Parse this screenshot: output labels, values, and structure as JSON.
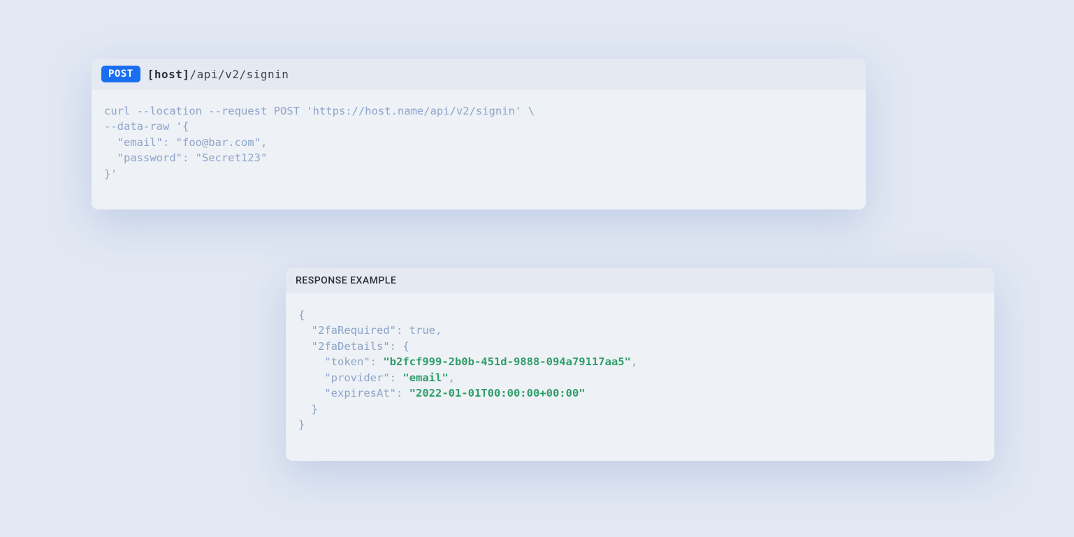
{
  "request": {
    "method": "POST",
    "host_label": "[host]",
    "path": "/api/v2/signin",
    "curl_lines": [
      "curl --location --request POST 'https://host.name/api/v2/signin' \\",
      "--data-raw '{",
      "  \"email\": \"foo@bar.com\",",
      "  \"password\": \"Secret123\"",
      "}'"
    ]
  },
  "response": {
    "title": "RESPONSE EXAMPLE",
    "json": {
      "open": "{",
      "lines": [
        {
          "indent": 1,
          "key": "\"2faRequired\"",
          "sep": ": ",
          "val": "true",
          "valClass": "json-bool",
          "trail": ","
        },
        {
          "indent": 1,
          "key": "\"2faDetails\"",
          "sep": ": ",
          "val": "{",
          "valClass": "json-punc",
          "trail": ""
        },
        {
          "indent": 2,
          "key": "\"token\"",
          "sep": ": ",
          "val": "\"b2fcf999-2b0b-451d-9888-094a79117aa5\"",
          "valClass": "json-str",
          "trail": ","
        },
        {
          "indent": 2,
          "key": "\"provider\"",
          "sep": ": ",
          "val": "\"email\"",
          "valClass": "json-str",
          "trail": ","
        },
        {
          "indent": 2,
          "key": "\"expiresAt\"",
          "sep": ": ",
          "val": "\"2022-01-01T00:00:00+00:00\"",
          "valClass": "json-str",
          "trail": ""
        },
        {
          "indent": 1,
          "raw": "}"
        }
      ],
      "close": "}"
    }
  }
}
